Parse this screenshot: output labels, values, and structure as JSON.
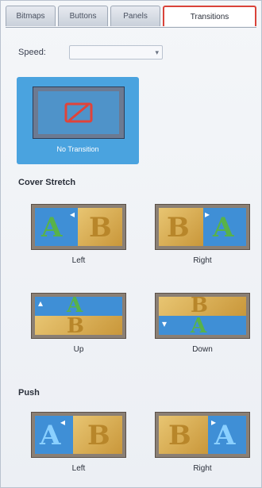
{
  "tabs": [
    {
      "label": "Bitmaps"
    },
    {
      "label": "Buttons"
    },
    {
      "label": "Panels"
    },
    {
      "label": "Transitions"
    }
  ],
  "speed": {
    "label": "Speed:",
    "value": ""
  },
  "selected": {
    "caption": "No Transition"
  },
  "sections": {
    "cover_stretch": "Cover Stretch",
    "push": "Push"
  },
  "cover": [
    {
      "label": "Left"
    },
    {
      "label": "Right"
    },
    {
      "label": "Up"
    },
    {
      "label": "Down"
    }
  ],
  "push_items": [
    {
      "label": "Left"
    },
    {
      "label": "Right"
    }
  ],
  "colors": {
    "accent": "#d9433a",
    "selected_bg": "#4aa3df",
    "pane_blue": "#3f8fd6",
    "pane_gold": "#d6a94f"
  }
}
